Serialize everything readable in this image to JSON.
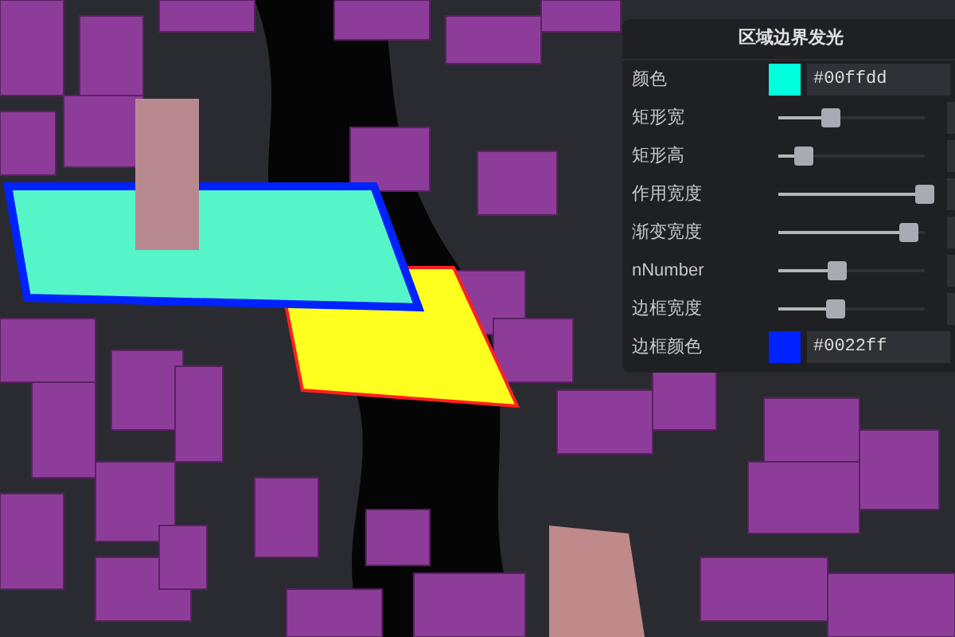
{
  "panel": {
    "title": "区域边界发光",
    "controls": [
      {
        "kind": "color",
        "label": "颜色",
        "value": "#00ffdd"
      },
      {
        "kind": "slider",
        "label": "矩形宽",
        "level": 0.36
      },
      {
        "kind": "slider",
        "label": "矩形高",
        "level": 0.17
      },
      {
        "kind": "slider",
        "label": "作用宽度",
        "level": 1.0
      },
      {
        "kind": "slider",
        "label": "渐变宽度",
        "level": 0.89
      },
      {
        "kind": "slider",
        "label": "nNumber",
        "level": 0.4
      },
      {
        "kind": "slider",
        "label": "边框宽度",
        "level": 0.39
      },
      {
        "kind": "color",
        "label": "边框颜色",
        "value": "#0022ff"
      }
    ]
  }
}
